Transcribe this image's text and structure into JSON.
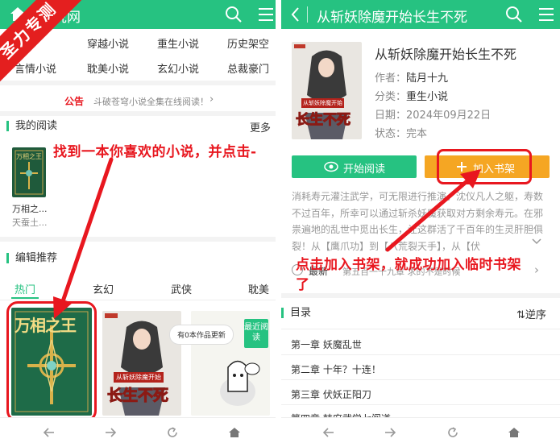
{
  "badge": {
    "text": "圣力专测"
  },
  "left": {
    "header": {
      "title_suffix": "说网"
    },
    "categories": [
      {
        "label": "穿越小说"
      },
      {
        "label": "重生小说"
      },
      {
        "label": "历史架空"
      },
      {
        "label": "言情小说"
      },
      {
        "label": "耽美小说"
      },
      {
        "label": "玄幻小说"
      },
      {
        "label": "总裁豪门"
      }
    ],
    "notice": {
      "tag": "公告",
      "text": "斗破苍穹小说全集在线阅读！",
      "arrow": "›"
    },
    "reading": {
      "title": "我的阅读",
      "more": "更多",
      "book_title": "万相之...",
      "book_author": "天蚕土..."
    },
    "annotation": {
      "text": "找到一本你喜欢的小说，并点击-"
    },
    "recommend": {
      "title": "编辑推荐",
      "tabs": [
        {
          "label": "热门"
        },
        {
          "label": "玄幻"
        },
        {
          "label": "武侠"
        },
        {
          "label": "耽美"
        }
      ],
      "cover1_text": "万相之王",
      "cover2_text": "长生不死",
      "cover2_ribbon": "从斩妖除魔开始",
      "cover3_bubble": "有0本作品更新",
      "cover3_badge": "最近阅读"
    }
  },
  "right": {
    "header": {
      "title": "从斩妖除魔开始长生不死"
    },
    "book": {
      "title": "从斩妖除魔开始长生不死",
      "author_label": "作者：",
      "author": "陆月十九",
      "category_label": "分类：",
      "category": "重生小说",
      "date_label": "日期：",
      "date": "2024年09月22日",
      "status_label": "状态：",
      "status": "完本",
      "cover_text": "长生不死",
      "cover_ribbon": "从斩妖除魔开始"
    },
    "buttons": {
      "read": "开始阅读",
      "add_shelf": "加入书架"
    },
    "description": "消耗寿元灌注武学，可无限进行推演。沈仪凡人之躯，寿数不过百年，所幸可以通过斩杀妖魔获取对方剩余寿元。在邪祟遍地的乱世中觅出长生，让这群活了千百年的生灵肝胆俱裂！从【鹰爪功】到【八荒裂天手】，从【伏",
    "annotation": {
      "line1": "点击加入书架，就成功加入临时书架",
      "line2": "了"
    },
    "latest": {
      "label": "最新",
      "text": "第五百一十九章 求的不是时候"
    },
    "toc": {
      "title": "目录",
      "sort": "逆序"
    },
    "chapters": [
      {
        "label": "第一章 妖魔乱世"
      },
      {
        "label": "第二章 十年？十连！"
      },
      {
        "label": "第三章 伏妖正阳刀"
      },
      {
        "label": "第四章 韩府武学七阁道"
      }
    ]
  },
  "colors": {
    "brand_green": "#26c281",
    "annotation_red": "#e8171f",
    "button_orange": "#f5a623",
    "badge_red": "#e41f1f"
  }
}
